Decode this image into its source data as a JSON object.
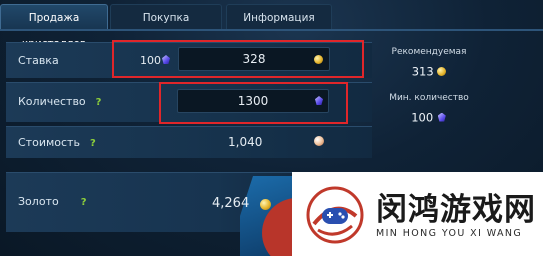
{
  "tabs": [
    {
      "label": "Продажа кристаллов"
    },
    {
      "label": "Покупка кристаллов"
    },
    {
      "label": "Информация"
    }
  ],
  "rows": {
    "bid": {
      "label": "Ставка",
      "crystal_count": "100",
      "gold_value": "328"
    },
    "quantity": {
      "label": "Количество",
      "help": "?",
      "value": "1300"
    },
    "cost": {
      "label": "Стоимость",
      "help": "?",
      "value": "1,040"
    },
    "gold": {
      "label": "Золото",
      "help": "?",
      "value": "4,264"
    }
  },
  "side": {
    "recommended_label": "Рекомендуемая",
    "recommended_value": "313",
    "min_label": "Мин. количество",
    "min_value": "100"
  },
  "icons": {
    "gold": "gold-coin-icon",
    "crystal": "crystal-icon",
    "cost": "currency-coin-icon"
  },
  "colors": {
    "highlight": "#e0262a",
    "help": "#8dcf3b",
    "accent": "#2d5479"
  },
  "watermark": {
    "cn": "闵鸿游戏网",
    "pinyin": "MIN HONG YOU XI WANG"
  }
}
